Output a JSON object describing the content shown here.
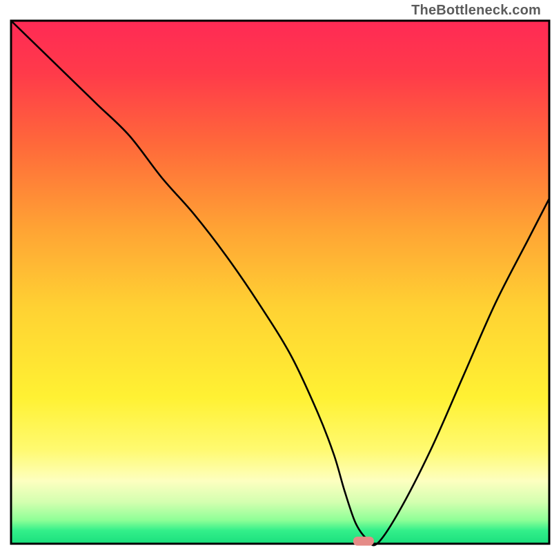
{
  "watermark": "TheBottleneck.com",
  "chart_data": {
    "type": "line",
    "title": "",
    "xlabel": "",
    "ylabel": "",
    "xlim": [
      0,
      100
    ],
    "ylim": [
      0,
      100
    ],
    "grid": false,
    "legend": false,
    "series": [
      {
        "name": "bottleneck-curve",
        "x": [
          0,
          4,
          10,
          16,
          22,
          28,
          34,
          40,
          46,
          52,
          57,
          60,
          62,
          64,
          66,
          68,
          72,
          78,
          84,
          90,
          96,
          100
        ],
        "y": [
          100,
          96,
          90,
          84,
          78,
          70,
          63,
          55,
          46,
          36,
          25,
          17,
          10,
          4,
          1,
          0,
          6,
          18,
          32,
          46,
          58,
          66
        ]
      }
    ],
    "markers": [
      {
        "name": "optimal-point",
        "x": 65.5,
        "y": 0.5,
        "color": "#e58b87",
        "shape": "capsule"
      }
    ],
    "gradient_stops": [
      {
        "offset": 0.0,
        "color": "#ff2a55"
      },
      {
        "offset": 0.1,
        "color": "#ff3a4a"
      },
      {
        "offset": 0.24,
        "color": "#ff6a3a"
      },
      {
        "offset": 0.4,
        "color": "#ffa434"
      },
      {
        "offset": 0.55,
        "color": "#ffd233"
      },
      {
        "offset": 0.72,
        "color": "#fff133"
      },
      {
        "offset": 0.82,
        "color": "#fffa70"
      },
      {
        "offset": 0.88,
        "color": "#fdffc0"
      },
      {
        "offset": 0.92,
        "color": "#d4ffb0"
      },
      {
        "offset": 0.955,
        "color": "#8eff97"
      },
      {
        "offset": 0.975,
        "color": "#33ef8a"
      },
      {
        "offset": 1.0,
        "color": "#1adf7d"
      }
    ]
  },
  "layout": {
    "plot_left": 16,
    "plot_top": 30,
    "plot_right": 796,
    "plot_bottom": 788,
    "frame_color": "#000000",
    "frame_width": 3
  }
}
